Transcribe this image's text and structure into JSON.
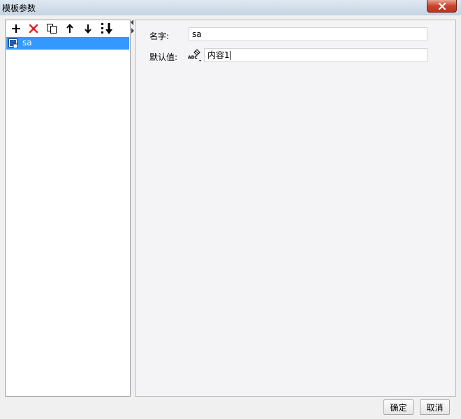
{
  "window": {
    "title": "模板参数"
  },
  "toolbar": {
    "buttons": [
      {
        "name": "add-icon"
      },
      {
        "name": "delete-icon"
      },
      {
        "name": "copy-icon"
      },
      {
        "name": "move-up-icon"
      },
      {
        "name": "move-down-icon"
      },
      {
        "name": "move-bottom-icon"
      }
    ]
  },
  "tree": {
    "items": [
      {
        "label": "sa",
        "selected": true
      }
    ]
  },
  "form": {
    "name_label": "名字:",
    "name_value": "sa",
    "default_label": "默认值:",
    "default_value": "内容1"
  },
  "footer": {
    "ok_label": "确定",
    "cancel_label": "取消"
  },
  "colors": {
    "selection": "#3399ff",
    "close_button": "#c9452c",
    "delete_icon": "#e02020"
  }
}
